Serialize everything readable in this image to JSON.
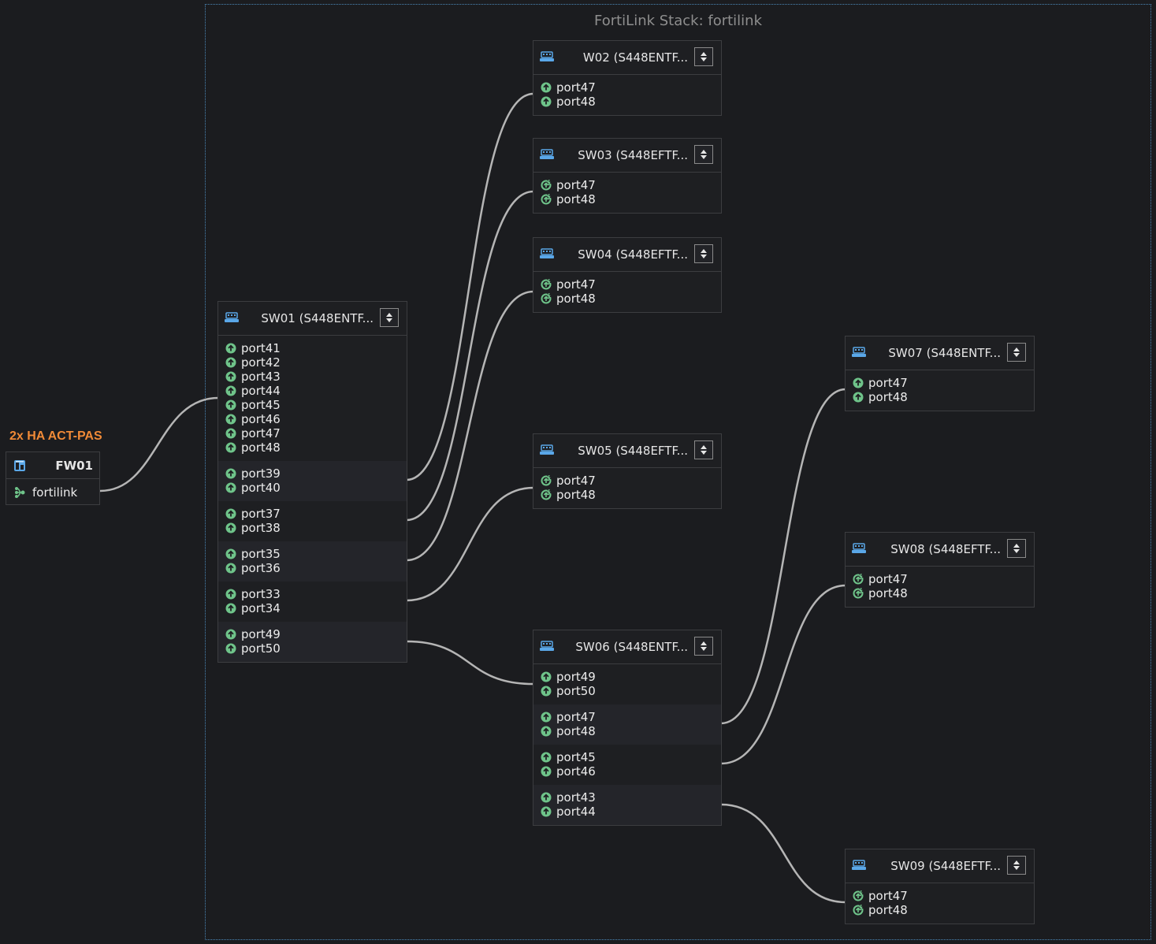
{
  "stack": {
    "title": "FortiLink Stack: fortilink"
  },
  "colors": {
    "accent": "#f08a37",
    "port_up": "#6fc48a",
    "link": "#b5b5b5",
    "switch_icon": "#5aa7e8",
    "frame": "#4a86b6"
  },
  "firewall": {
    "ha_label": "2x HA ACT-PAS",
    "name": "FW01",
    "icon": "firewall-icon",
    "port": "fortilink",
    "port_icon": "fortilink-icon"
  },
  "switches": {
    "sw01": {
      "title": "SW01 (S448ENTF...",
      "groups": [
        [
          "port41",
          "port42",
          "port43",
          "port44",
          "port45",
          "port46",
          "port47",
          "port48"
        ],
        [
          "port39",
          "port40"
        ],
        [
          "port37",
          "port38"
        ],
        [
          "port35",
          "port36"
        ],
        [
          "port33",
          "port34"
        ],
        [
          "port49",
          "port50"
        ]
      ]
    },
    "sw02": {
      "title": "W02 (S448ENTF...",
      "groups": [
        [
          "port47",
          "port48"
        ]
      ]
    },
    "sw03": {
      "title": "SW03 (S448EFTF...",
      "groups": [
        [
          "port47",
          "port48"
        ]
      ]
    },
    "sw04": {
      "title": "SW04 (S448EFTF...",
      "groups": [
        [
          "port47",
          "port48"
        ]
      ]
    },
    "sw05": {
      "title": "SW05 (S448EFTF...",
      "groups": [
        [
          "port47",
          "port48"
        ]
      ]
    },
    "sw06": {
      "title": "SW06 (S448ENTF...",
      "groups": [
        [
          "port49",
          "port50"
        ],
        [
          "port47",
          "port48"
        ],
        [
          "port45",
          "port46"
        ],
        [
          "port43",
          "port44"
        ]
      ]
    },
    "sw07": {
      "title": "SW07 (S448ENTF...",
      "groups": [
        [
          "port47",
          "port48"
        ]
      ]
    },
    "sw08": {
      "title": "SW08 (S448EFTF...",
      "groups": [
        [
          "port47",
          "port48"
        ]
      ]
    },
    "sw09": {
      "title": "SW09 (S448EFTF...",
      "groups": [
        [
          "port47",
          "port48"
        ]
      ]
    }
  },
  "port_status": {
    "up": "port-up-icon",
    "poe": "port-poe-up-icon"
  }
}
